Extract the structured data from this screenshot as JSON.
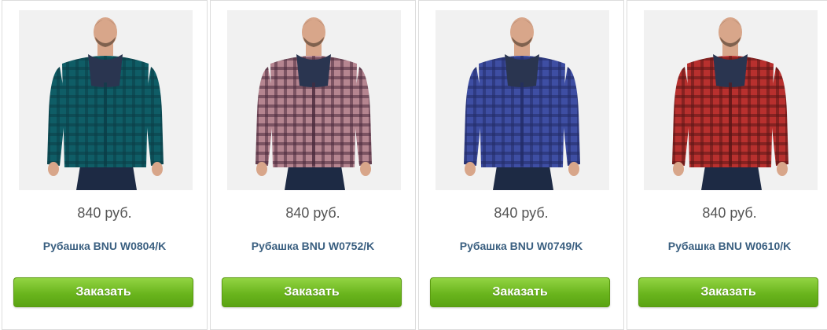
{
  "products": [
    {
      "price": "840 руб.",
      "title": "Рубашка BNU W0804/K",
      "button_label": "Заказать",
      "image": "teal-plaid-hooded-shirt",
      "shirt_color": "#0f5d66",
      "stripe_color": "#0a3d47"
    },
    {
      "price": "840 руб.",
      "title": "Рубашка BNU W0752/K",
      "button_label": "Заказать",
      "image": "pink-plaid-hooded-shirt",
      "shirt_color": "#b58590",
      "stripe_color": "#4a2a3c"
    },
    {
      "price": "840 руб.",
      "title": "Рубашка BNU W0749/K",
      "button_label": "Заказать",
      "image": "blue-plaid-hooded-shirt",
      "shirt_color": "#3e4ea3",
      "stripe_color": "#222b66"
    },
    {
      "price": "840 руб.",
      "title": "Рубашка BNU W0610/K",
      "button_label": "Заказать",
      "image": "red-plaid-hooded-shirt",
      "shirt_color": "#b8302e",
      "stripe_color": "#5a1515"
    }
  ]
}
